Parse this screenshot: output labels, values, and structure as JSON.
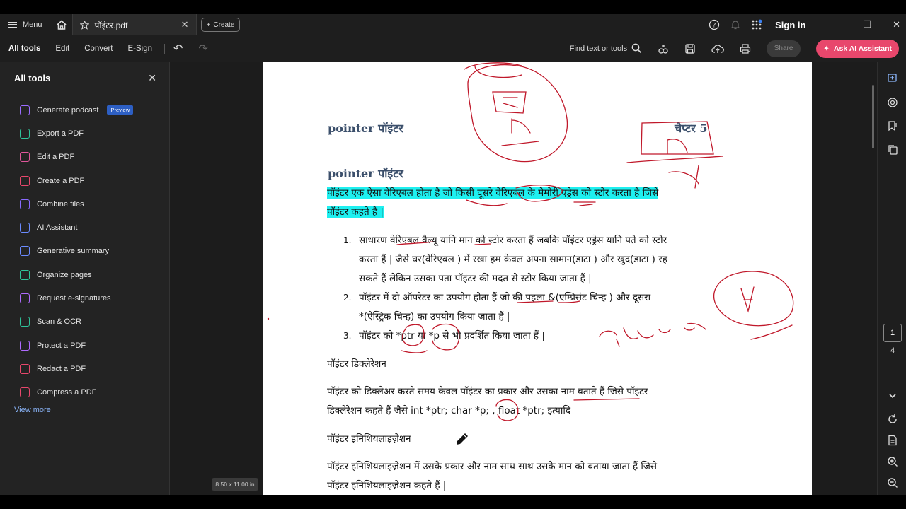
{
  "titlebar": {
    "menu_label": "Menu",
    "tab_title": "पॉइंटर.pdf",
    "create_label": "Create",
    "sign_in": "Sign in"
  },
  "toolbar": {
    "tabs": [
      "All tools",
      "Edit",
      "Convert",
      "E-Sign"
    ],
    "find_label": "Find text or tools",
    "share_label": "Share",
    "ask_ai_label": "Ask AI Assistant"
  },
  "sidebar": {
    "title": "All tools",
    "items": [
      {
        "label": "Generate podcast",
        "color": "#9b6bff"
      },
      {
        "label": "Export a PDF",
        "color": "#2fc39a"
      },
      {
        "label": "Edit a PDF",
        "color": "#e0569b"
      },
      {
        "label": "Create a PDF",
        "color": "#e8476c"
      },
      {
        "label": "Combine files",
        "color": "#8a6bff"
      },
      {
        "label": "AI Assistant",
        "color": "#6b8bff"
      },
      {
        "label": "Generative summary",
        "color": "#6b8bff"
      },
      {
        "label": "Organize pages",
        "color": "#2fc39a"
      },
      {
        "label": "Request e-signatures",
        "color": "#b06bff"
      },
      {
        "label": "Scan & OCR",
        "color": "#2fc39a"
      },
      {
        "label": "Protect a PDF",
        "color": "#b06bff"
      },
      {
        "label": "Redact a PDF",
        "color": "#e8476c"
      },
      {
        "label": "Compress a PDF",
        "color": "#e8476c"
      }
    ],
    "preview_badge": "Preview",
    "view_more": "View more"
  },
  "page_size": "8.50 x 11.00 in",
  "document": {
    "header_left": "pointer पॉइंटर",
    "header_right": "चैप्टर 5",
    "heading": "pointer पॉइंटर",
    "intro_line1": "पॉइंटर एक ऐसा वेरिएबल होता है जो किसी दूसरे वेरिएबल के मेमोरी एड्रेस को स्टोर करता है जिसे",
    "intro_line2": "पॉइंटर कहते है |",
    "list": [
      {
        "num": "1.",
        "line1": "साधारण वेरिएबल वैल्यू यानि मान को स्टोर करता हैं जबकि पॉइंटर एड्रेस यानि पते को स्टोर",
        "line2": "करता हैं | जैसे घर(वेरिएबल ) में रखा हम केवल अपना सामान(डाटा ) और खुद(डाटा ) रह",
        "line3": "सकते हैं लेकिन उसका पता पॉइंटर की मदत से स्टोर किया जाता हैं |"
      },
      {
        "num": "2.",
        "line1": "पॉइंटर में दो ऑपरेटर का उपयोग होता हैं जो की पहला &(एम्प्रिसंट चिन्ह ) और दूसरा",
        "line2": "*(ऐस्ट्रिक चिन्ह) का उपयोग किया जाता हैं |"
      },
      {
        "num": "3.",
        "line1": "पॉइंटर को *ptr या *p से भी प्रदर्शित किया जाता हैं |"
      }
    ],
    "decl_heading": "पॉइंटर डिक्लेरेशन",
    "decl_line1": "पॉइंटर को डिक्लेअर करते समय केवल पॉइंटर का प्रकार और उसका नाम बताते हैं जिसे पॉइंटर",
    "decl_line2": "डिक्लेरेशन कहते हैं  जैसे int *ptr;  char *p;  , float *ptr; इत्यादि",
    "init_heading": "पॉइंटर इनिशियलाइज़ेशन",
    "init_line1": "पॉइंटर इनिशियलाइज़ेशन में उसके प्रकार और नाम साथ साथ उसके मान को बताया जाता हैं जिसे",
    "init_line2": "पॉइंटर इनिशियलाइज़ेशन कहते हैं |"
  },
  "pagination": {
    "current": "1",
    "total": "4"
  }
}
